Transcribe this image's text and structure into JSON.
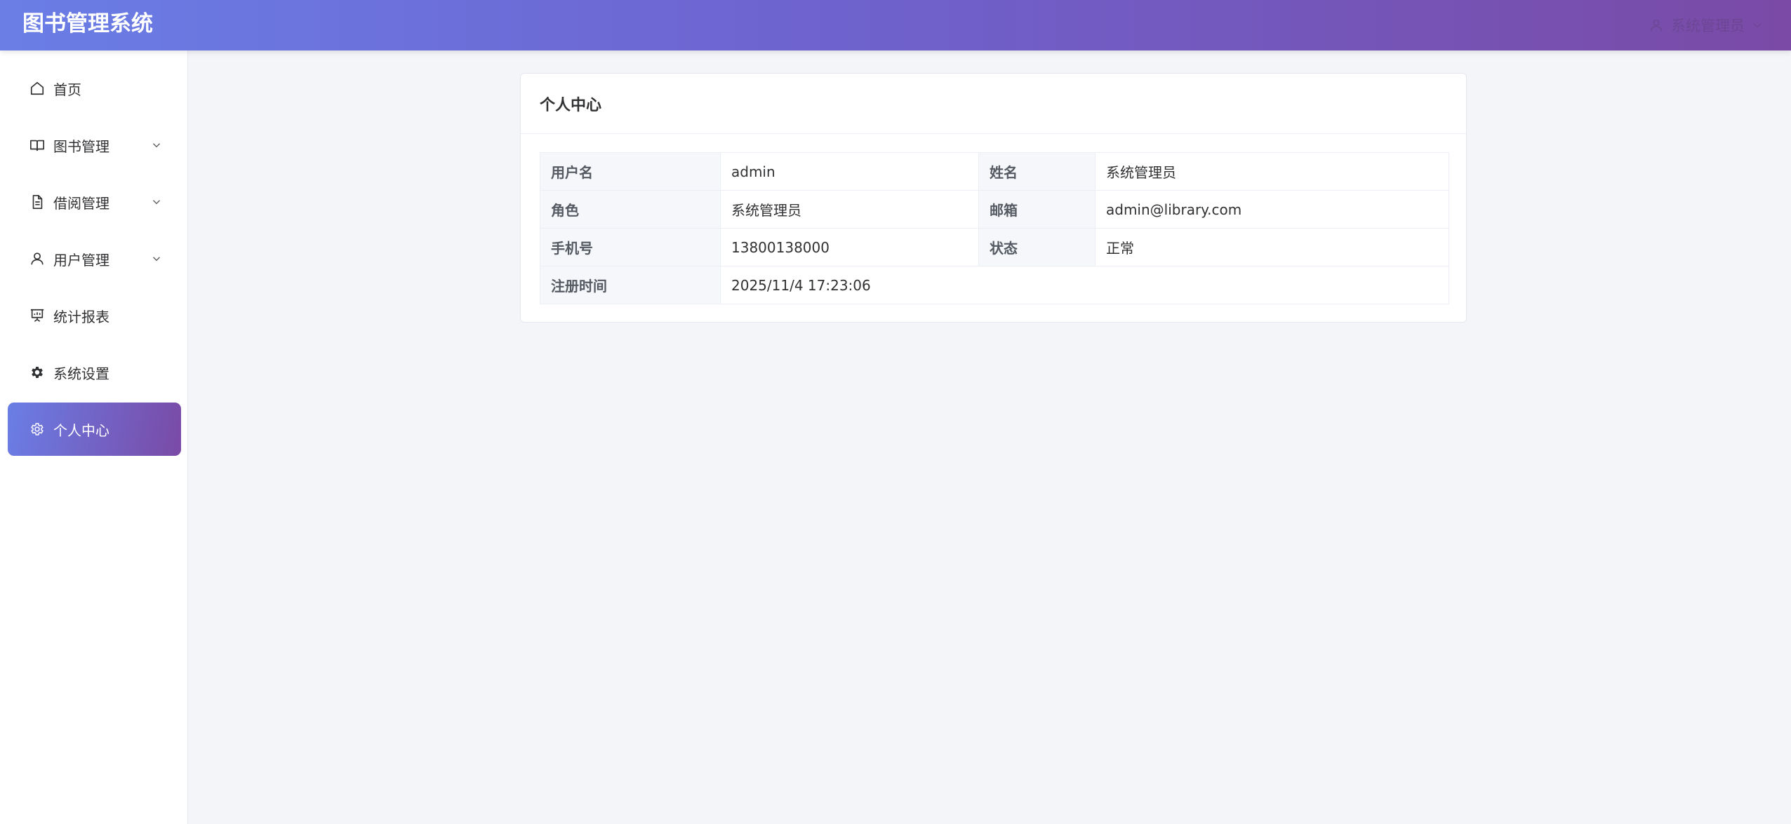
{
  "app": {
    "title": "图书管理系统"
  },
  "header": {
    "user_name": "系统管理员"
  },
  "sidebar": {
    "items": [
      {
        "label": "首页"
      },
      {
        "label": "图书管理"
      },
      {
        "label": "借阅管理"
      },
      {
        "label": "用户管理"
      },
      {
        "label": "统计报表"
      },
      {
        "label": "系统设置"
      },
      {
        "label": "个人中心"
      }
    ],
    "active_item": "个人中心"
  },
  "profile": {
    "title": "个人中心",
    "fields": {
      "username_label": "用户名",
      "username": "admin",
      "name_label": "姓名",
      "name": "系统管理员",
      "role_label": "角色",
      "role": "系统管理员",
      "email_label": "邮箱",
      "email": "admin@library.com",
      "phone_label": "手机号",
      "phone": "13800138000",
      "status_label": "状态",
      "status": "正常",
      "registered_label": "注册时间",
      "registered": "2025/11/4 17:23:06"
    }
  },
  "colors": {
    "header_gradient_start": "#6a7ee6",
    "header_gradient_end": "#7a4aa6",
    "active_menu_gradient_start": "#6a7ee6",
    "active_menu_gradient_end": "#7a4aa6",
    "page_background": "#f4f5f9"
  },
  "icons": {
    "home": "home-icon",
    "books": "book-icon",
    "borrow": "document-icon",
    "users": "user-icon",
    "reports": "presentation-chart-icon",
    "settings": "gear-icon",
    "profile": "gear-outline-icon",
    "expand": "chevron-down-icon"
  }
}
